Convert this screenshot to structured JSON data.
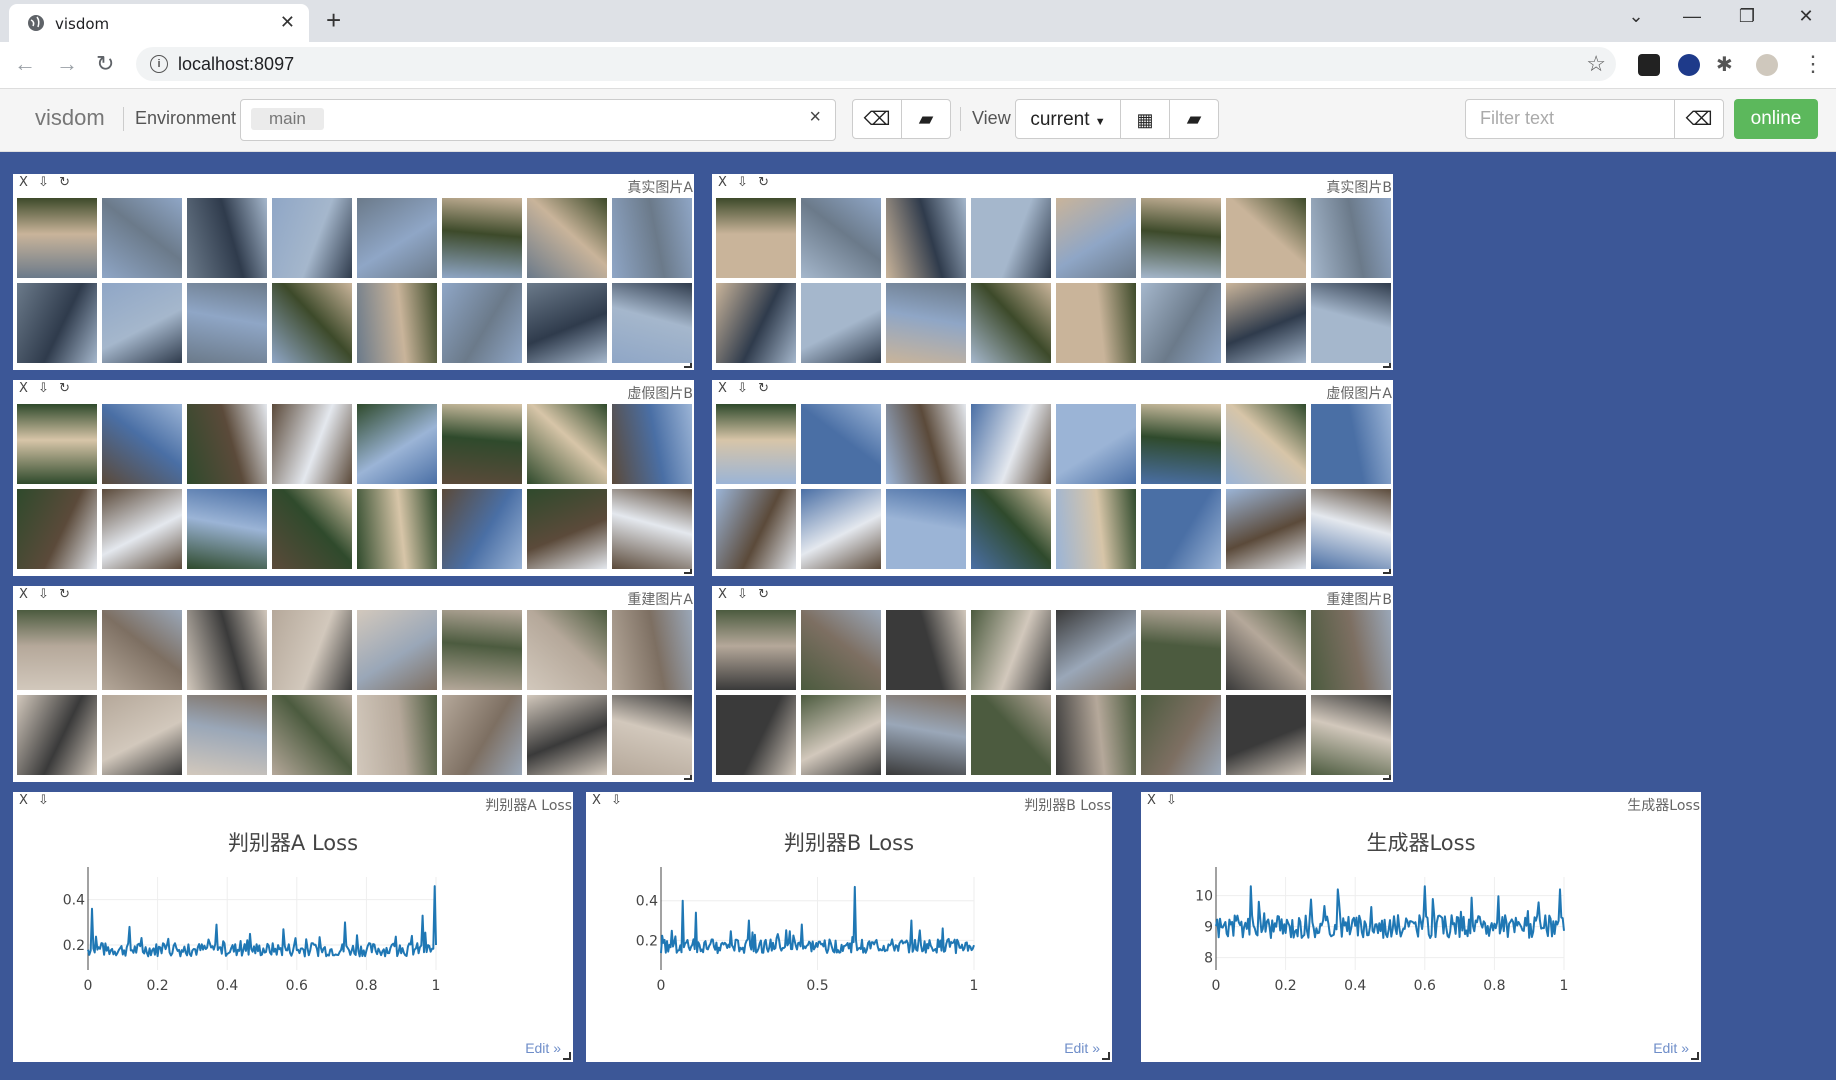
{
  "browser": {
    "tab_title": "visdom",
    "url": "localhost:8097"
  },
  "visdom_nav": {
    "brand": "visdom",
    "environment_label": "Environment",
    "environment_value": "main",
    "view_label": "View",
    "view_value": "current",
    "filter_placeholder": "Filter text",
    "status": "online"
  },
  "image_panes": [
    {
      "title": "真实图片A",
      "icons": [
        "close-icon",
        "download-icon",
        "reset-icon"
      ]
    },
    {
      "title": "真实图片B",
      "icons": [
        "close-icon",
        "download-icon",
        "reset-icon"
      ]
    },
    {
      "title": "虚假图片B",
      "icons": [
        "close-icon",
        "download-icon",
        "reset-icon"
      ]
    },
    {
      "title": "虚假图片A",
      "icons": [
        "close-icon",
        "download-icon",
        "reset-icon"
      ]
    },
    {
      "title": "重建图片A",
      "icons": [
        "close-icon",
        "download-icon",
        "reset-icon"
      ]
    },
    {
      "title": "重建图片B",
      "icons": [
        "close-icon",
        "download-icon",
        "reset-icon"
      ]
    }
  ],
  "pane_control_close": "X",
  "edit_link": "Edit »",
  "chart_data": [
    {
      "type": "line",
      "pane_title": "判别器A Loss",
      "title": "判别器A Loss",
      "xlim": [
        0,
        1
      ],
      "ylim": [
        0.09,
        0.5
      ],
      "xticks": [
        "0",
        "0.2",
        "0.4",
        "0.6",
        "0.8",
        "1"
      ],
      "yticks": [
        "0.2",
        "0.4"
      ],
      "baseline": 0.18,
      "noise": 0.03,
      "spikes": [
        [
          0.01,
          0.36
        ],
        [
          0.12,
          0.28
        ],
        [
          0.37,
          0.29
        ],
        [
          0.56,
          0.27
        ],
        [
          0.74,
          0.3
        ],
        [
          0.96,
          0.33
        ],
        [
          0.995,
          0.46
        ]
      ],
      "color": "#1f77b4"
    },
    {
      "type": "line",
      "pane_title": "判别器B Loss",
      "title": "判别器B Loss",
      "xlim": [
        0,
        1
      ],
      "ylim": [
        0.05,
        0.52
      ],
      "xticks": [
        "0",
        "0.5",
        "1"
      ],
      "yticks": [
        "0.2",
        "0.4"
      ],
      "baseline": 0.17,
      "noise": 0.035,
      "spikes": [
        [
          0.07,
          0.4
        ],
        [
          0.11,
          0.34
        ],
        [
          0.28,
          0.3
        ],
        [
          0.45,
          0.28
        ],
        [
          0.62,
          0.47
        ],
        [
          0.8,
          0.3
        ],
        [
          0.9,
          0.26
        ]
      ],
      "color": "#1f77b4"
    },
    {
      "type": "line",
      "pane_title": "生成器Loss",
      "title": "生成器Loss",
      "xlim": [
        0,
        1
      ],
      "ylim": [
        7.6,
        10.6
      ],
      "xticks": [
        "0",
        "0.2",
        "0.4",
        "0.6",
        "0.8",
        "1"
      ],
      "yticks": [
        "8",
        "9",
        "10"
      ],
      "baseline": 9.0,
      "noise": 0.38,
      "spikes": [
        [
          0.1,
          10.3
        ],
        [
          0.35,
          10.2
        ],
        [
          0.6,
          10.3
        ],
        [
          0.99,
          10.2
        ]
      ],
      "color": "#1f77b4"
    }
  ]
}
